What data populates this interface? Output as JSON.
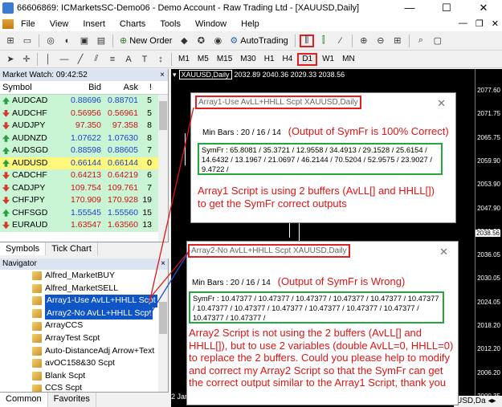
{
  "window": {
    "title": "66606869: ICMarketsSC-Demo06 - Demo Account - Raw Trading Ltd - [XAUUSD,Daily]",
    "min": "—",
    "max": "☐",
    "close": "✕"
  },
  "menu": {
    "items": [
      "File",
      "View",
      "Insert",
      "Charts",
      "Tools",
      "Window",
      "Help"
    ],
    "right_min": "—",
    "right_restore": "❐",
    "right_close": "✕"
  },
  "toolbar": {
    "new_order": "New Order",
    "autotrading": "AutoTrading"
  },
  "timeframes": [
    "M1",
    "M5",
    "M15",
    "M30",
    "H1",
    "H4",
    "D1",
    "W1",
    "MN"
  ],
  "timeframe_active": "D1",
  "market_watch": {
    "header": "Market Watch: 09:42:52",
    "close": "×",
    "col_symbol": "Symbol",
    "col_bid": "Bid",
    "col_ask": "Ask",
    "col_spread": "!",
    "rows": [
      {
        "symbol": "AUDCAD",
        "bid": "0.88696",
        "ask": "0.88701",
        "spread": "5",
        "dir": "up"
      },
      {
        "symbol": "AUDCHF",
        "bid": "0.56956",
        "ask": "0.56961",
        "spread": "5",
        "dir": "down"
      },
      {
        "symbol": "AUDJPY",
        "bid": "97.350",
        "ask": "97.358",
        "spread": "8",
        "dir": "down"
      },
      {
        "symbol": "AUDNZD",
        "bid": "1.07622",
        "ask": "1.07630",
        "spread": "8",
        "dir": "up"
      },
      {
        "symbol": "AUDSGD",
        "bid": "0.88598",
        "ask": "0.88605",
        "spread": "7",
        "dir": "up"
      },
      {
        "symbol": "AUDUSD",
        "bid": "0.66144",
        "ask": "0.66144",
        "spread": "0",
        "dir": "up",
        "selected": true
      },
      {
        "symbol": "CADCHF",
        "bid": "0.64213",
        "ask": "0.64219",
        "spread": "6",
        "dir": "down"
      },
      {
        "symbol": "CADJPY",
        "bid": "109.754",
        "ask": "109.761",
        "spread": "7",
        "dir": "down"
      },
      {
        "symbol": "CHFJPY",
        "bid": "170.909",
        "ask": "170.928",
        "spread": "19",
        "dir": "down"
      },
      {
        "symbol": "CHFSGD",
        "bid": "1.55545",
        "ask": "1.55560",
        "spread": "15",
        "dir": "up"
      },
      {
        "symbol": "EURAUD",
        "bid": "1.63547",
        "ask": "1.63560",
        "spread": "13",
        "dir": "down"
      }
    ],
    "tabs": [
      "Symbols",
      "Tick Chart"
    ]
  },
  "navigator": {
    "header": "Navigator",
    "close": "×",
    "items": [
      {
        "label": "Alfred_MarketBUY",
        "selected": false
      },
      {
        "label": "Alfred_MarketSELL",
        "selected": false
      },
      {
        "label": "Array1-Use AvLL+HHLL Scpt",
        "selected": true
      },
      {
        "label": "Array2-No AvLL+HHLL Scpt",
        "selected": true
      },
      {
        "label": "ArrayCCS",
        "selected": false
      },
      {
        "label": "ArrayTest Scpt",
        "selected": false
      },
      {
        "label": "Auto-DistanceAdj Arrow+Text",
        "selected": false
      },
      {
        "label": "avOC158&30 Scpt",
        "selected": false
      },
      {
        "label": "Blank Scpt",
        "selected": false
      },
      {
        "label": "CCS Scpt",
        "selected": false
      }
    ],
    "tabs": [
      "Common",
      "Favorites"
    ]
  },
  "chart": {
    "tab_symbol": "XAUUSD,Daily",
    "tab_values": "2032.89 2040.36 2029.33 2038.56",
    "price_ticks": [
      "2077.60",
      "2071.75",
      "2065.75",
      "2059.90",
      "2053.90",
      "2047.90",
      "2041.90",
      "2038.56",
      "2036.05",
      "2030.05",
      "2024.05",
      "2018.20",
      "2012.20",
      "2006.20",
      "2000.35"
    ],
    "bottom_label": "USD,Da",
    "bottom_label_left": "2 Jar"
  },
  "popup1": {
    "title": "Array1-Use AvLL+HHLL Scpt XAUUSD,Daily",
    "close": "✕",
    "min_bars": "Min Bars : 20 / 16 / 14",
    "note": "(Output of SymFr is 100% Correct)",
    "symfr": "SymFr : 65.8081 / 35.3721 / 12.9558 / 34.4913 / 29.1528 / 25.6154 / 14.6432 / 13.1967 / 21.0697 / 46.2144 / 70.5204 / 52.9575 / 23.9027 / 9.4722 /",
    "explain": "Array1 Script is using 2 buffers (AvLL[] and HHLL[]) to get the SymFr correct outputs"
  },
  "popup2": {
    "title": "Array2-No AvLL+HHLL Scpt XAUUSD,Daily",
    "close": "✕",
    "min_bars": "Min Bars : 20 / 16 / 14",
    "note": "(Output of SymFr is Wrong)",
    "symfr": "SymFr : 10.47377 / 10.47377 / 10.47377 / 10.47377 / 10.47377 / 10.47377 / 10.47377 / 10.47377 / 10.47377 / 10.47377 / 10.47377 / 10.47377 / 10.47377 / 10.47377 /",
    "explain": "Array2 Script is not using the 2 buffers (AvLL[] and HHLL[]), but to use 2 variables (double AvLL=0, HHLL=0) to replace the 2 buffers. Could you please help to modify and correct my Array2 Script so that the SymFr can get the correct output similar to the Array1 Script, thank you"
  },
  "colors": {
    "up": "#2e9e44",
    "down": "#d33b2b",
    "annotation": "#e01515",
    "highlight_box": "#e02020",
    "symfr_box": "#22a83a"
  }
}
